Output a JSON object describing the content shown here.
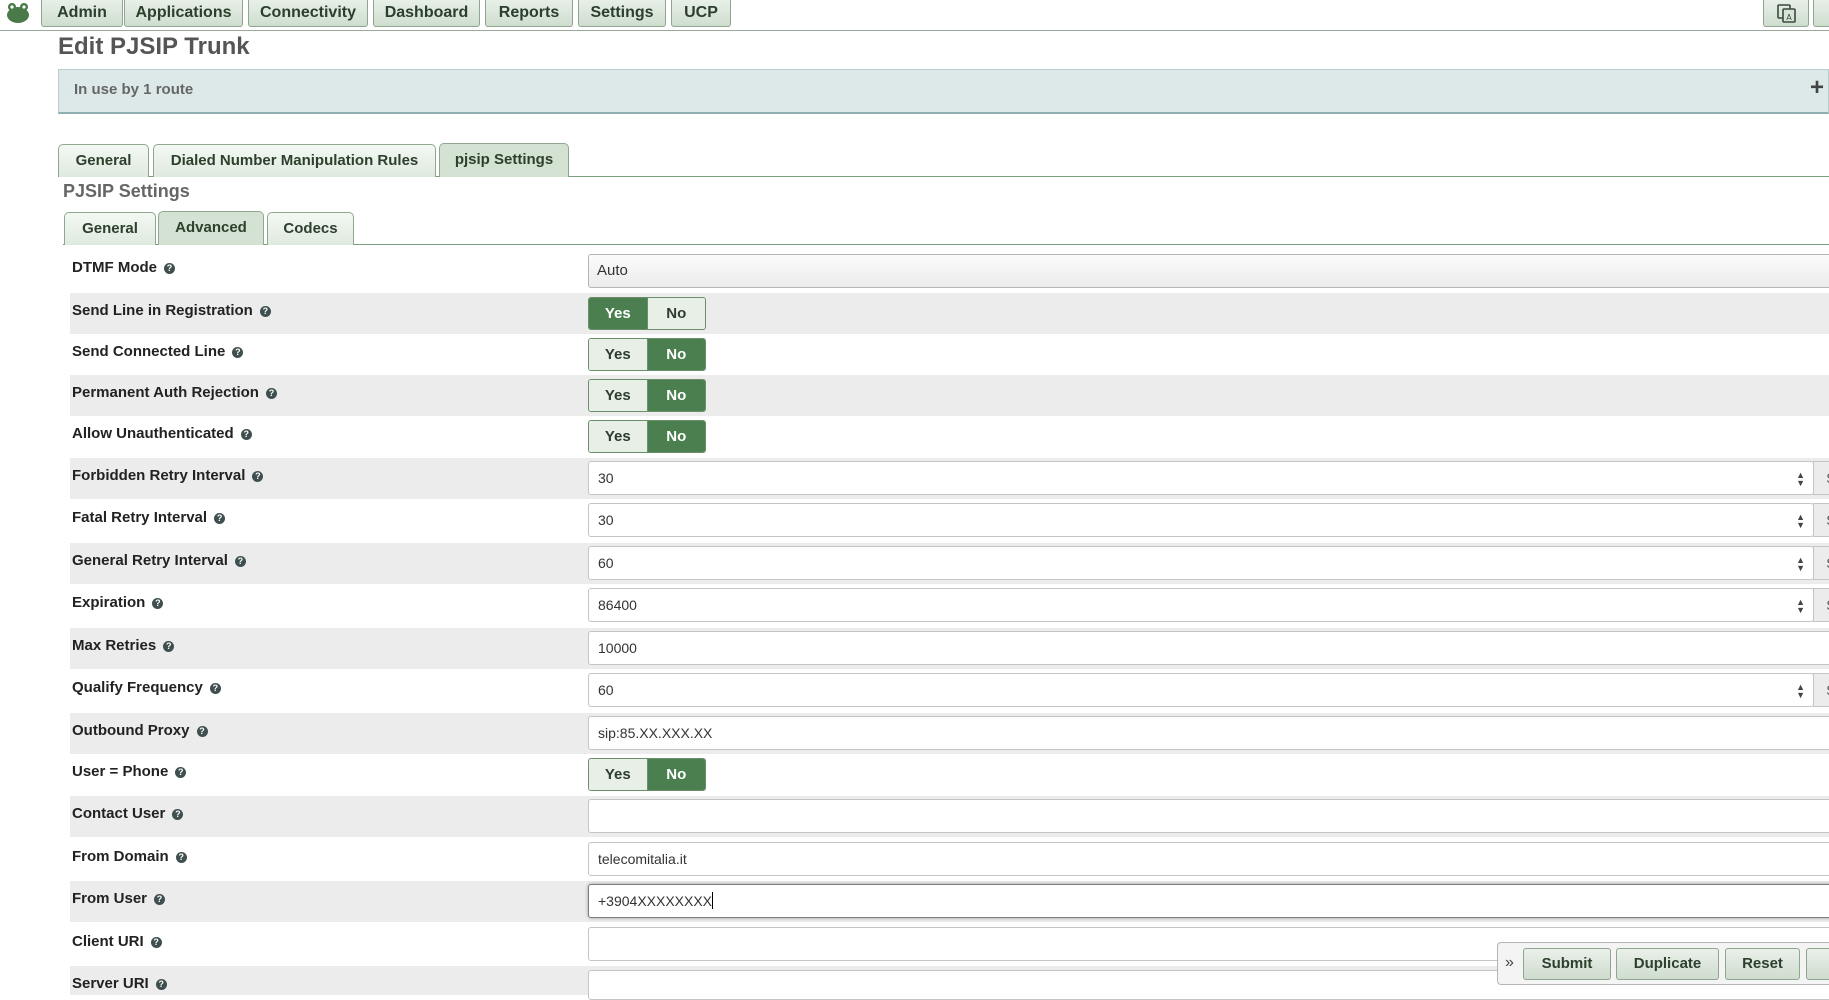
{
  "nav": {
    "items": [
      "Admin",
      "Applications",
      "Connectivity",
      "Dashboard",
      "Reports",
      "Settings",
      "UCP"
    ]
  },
  "page": {
    "title": "Edit PJSIP Trunk",
    "banner": "In use by 1 route",
    "banner_toggle": "+"
  },
  "tabs": {
    "main": [
      "General",
      "Dialed Number Manipulation Rules",
      "pjsip Settings"
    ],
    "main_active": "pjsip Settings",
    "section_title": "PJSIP Settings",
    "sub": [
      "General",
      "Advanced",
      "Codecs"
    ],
    "sub_active": "Advanced"
  },
  "toggle_labels": {
    "yes": "Yes",
    "no": "No"
  },
  "addon_unit": "Seconds",
  "fields": {
    "dtmf_mode": {
      "label": "DTMF Mode",
      "value": "Auto"
    },
    "send_line": {
      "label": "Send Line in Registration",
      "value": "Yes"
    },
    "send_connected": {
      "label": "Send Connected Line",
      "value": "No"
    },
    "perm_auth": {
      "label": "Permanent Auth Rejection",
      "value": "No"
    },
    "allow_unauth": {
      "label": "Allow Unauthenticated",
      "value": "No"
    },
    "forbidden_retry": {
      "label": "Forbidden Retry Interval",
      "value": "30"
    },
    "fatal_retry": {
      "label": "Fatal Retry Interval",
      "value": "30"
    },
    "general_retry": {
      "label": "General Retry Interval",
      "value": "60"
    },
    "expiration": {
      "label": "Expiration",
      "value": "86400"
    },
    "max_retries": {
      "label": "Max Retries",
      "value": "10000"
    },
    "qualify_freq": {
      "label": "Qualify Frequency",
      "value": "60"
    },
    "outbound_proxy": {
      "label": "Outbound Proxy",
      "value": "sip:85.XX.XXX.XX"
    },
    "user_phone": {
      "label": "User = Phone",
      "value": "No"
    },
    "contact_user": {
      "label": "Contact User",
      "value": ""
    },
    "from_domain": {
      "label": "From Domain",
      "value": "telecomitalia.it"
    },
    "from_user": {
      "label": "From User",
      "value": "+3904XXXXXXXX"
    },
    "client_uri": {
      "label": "Client URI",
      "value": ""
    },
    "server_uri": {
      "label": "Server URI",
      "value": ""
    }
  },
  "actions": {
    "submit": "Submit",
    "duplicate": "Duplicate",
    "reset": "Reset",
    "expand": "»"
  },
  "colors": {
    "toggle_on": "#4b7f50",
    "banner_bg": "#dde9e9",
    "nav_border": "#8fa78f"
  }
}
